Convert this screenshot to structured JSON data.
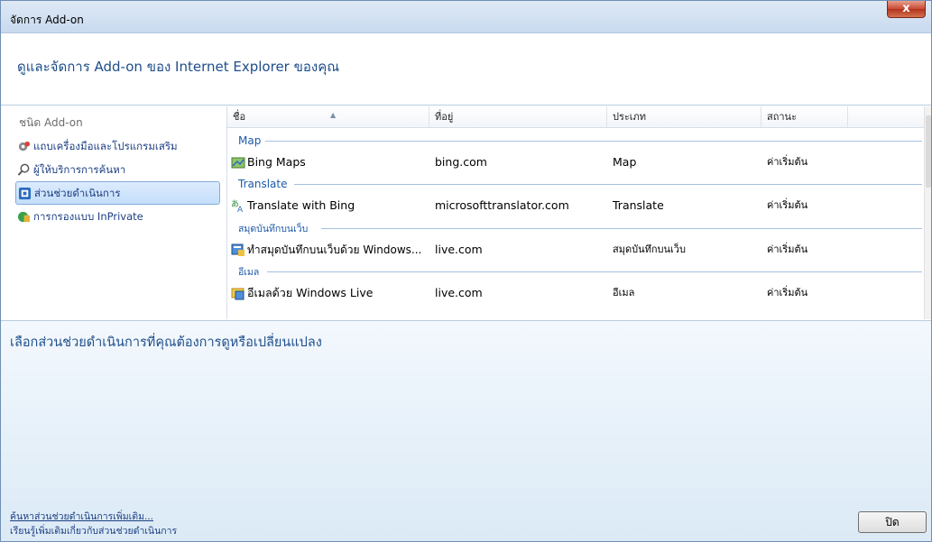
{
  "window": {
    "title": "จัดการ Add-on",
    "close_label": "x"
  },
  "header": {
    "heading": "ดูและจัดการ Add-on ของ Internet Explorer ของคุณ"
  },
  "sidebar": {
    "caption": "ชนิด Add-on",
    "items": [
      {
        "label": "แถบเครื่องมือและโปรแกรมเสริม",
        "icon": "gear-icon"
      },
      {
        "label": "ผู้ให้บริการการค้นหา",
        "icon": "search-icon"
      },
      {
        "label": "ส่วนช่วยดำเนินการ",
        "icon": "accelerator-icon",
        "selected": true
      },
      {
        "label": "การกรองแบบ InPrivate",
        "icon": "inprivate-icon"
      }
    ]
  },
  "list": {
    "columns": [
      "ชื่อ",
      "ที่อยู่",
      "ประเภท",
      "สถานะ"
    ],
    "groups": [
      {
        "label": "Map",
        "row": {
          "name": "Bing Maps",
          "address": "bing.com",
          "type": "Map",
          "status": "ค่าเริ่มต้น",
          "icon": "map-icon"
        }
      },
      {
        "label": "Translate",
        "row": {
          "name": "Translate with Bing",
          "address": "microsofttranslator.com",
          "type": "Translate",
          "status": "ค่าเริ่มต้น",
          "icon": "translate-icon"
        }
      },
      {
        "label": "สมุดบันทึกบนเว็บ",
        "row": {
          "name": "ทำสมุดบันทึกบนเว็บด้วย Windows...",
          "address": "live.com",
          "type": "สมุดบันทึกบนเว็บ",
          "status": "ค่าเริ่มต้น",
          "icon": "blog-icon"
        }
      },
      {
        "label": "อีเมล",
        "row": {
          "name": "อีเมลด้วย Windows Live",
          "address": "live.com",
          "type": "อีเมล",
          "status": "ค่าเริ่มต้น",
          "icon": "email-icon"
        }
      }
    ]
  },
  "details": {
    "prompt": "เลือกส่วนช่วยดำเนินการที่คุณต้องการดูหรือเปลี่ยนแปลง",
    "link_find_more": "ค้นหาส่วนช่วยดำเนินการเพิ่มเติม...",
    "link_learn_more": "เรียนรู้เพิ่มเติมเกี่ยวกับส่วนช่วยดำเนินการ",
    "close_button": "ปิด"
  }
}
